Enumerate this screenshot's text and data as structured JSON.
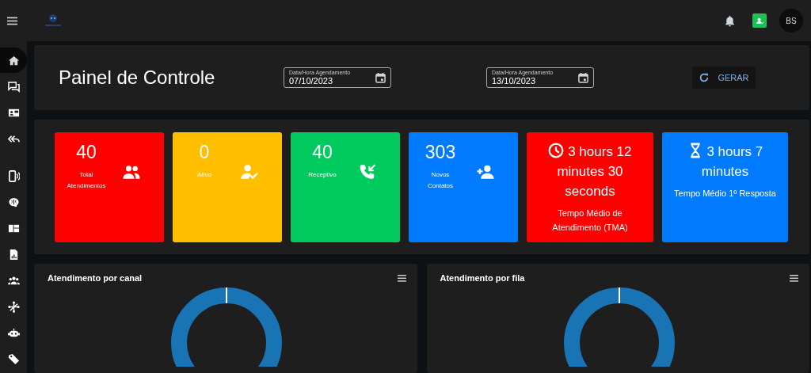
{
  "topbar": {
    "avatar": "BS"
  },
  "sidebar": {
    "items": [
      {
        "selected": true
      },
      {
        "selected": false
      },
      {
        "selected": false
      },
      {
        "selected": false
      },
      {
        "selected": false
      },
      {
        "selected": false
      },
      {
        "selected": false
      },
      {
        "selected": false
      },
      {
        "selected": false
      },
      {
        "selected": false
      },
      {
        "selected": false
      },
      {
        "selected": false
      }
    ]
  },
  "header": {
    "title": "Painel de Controle",
    "date_fields": [
      {
        "label": "Data/Hora Agendamento",
        "value": "07/10/2023"
      },
      {
        "label": "Data/Hora Agendamento",
        "value": "13/10/2023"
      }
    ],
    "button": "GERAR"
  },
  "stats": [
    {
      "kind": "count",
      "color": "#ff0000",
      "value": "40",
      "label": "Total Atendimentos"
    },
    {
      "kind": "count",
      "color": "#ffbf00",
      "value": "0",
      "label": "Ativo"
    },
    {
      "kind": "count",
      "color": "#00c95e",
      "value": "40",
      "label": "Receptivo"
    },
    {
      "kind": "count",
      "color": "#007bff",
      "value": "303",
      "label": "Novos Contatos"
    },
    {
      "kind": "time",
      "color": "#ff0000",
      "value": "3 hours 12 minutes 30 seconds",
      "label": "Tempo Médio de Atendimento (TMA)"
    },
    {
      "kind": "time",
      "color": "#007bff",
      "value": "3 hours 7 minutes",
      "label": "Tempo Médio 1º Resposta"
    }
  ],
  "charts": [
    {
      "title": "Atendimento por canal"
    },
    {
      "title": "Atendimento por fila"
    }
  ]
}
